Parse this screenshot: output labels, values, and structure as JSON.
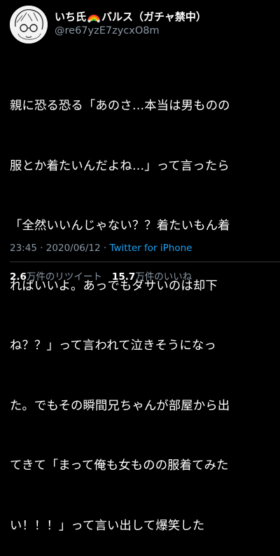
{
  "user": {
    "name_part1": "いち氏",
    "name_part2": "バルス（ガチャ禁中）",
    "handle": "@re67yzE7zycxO8m",
    "avatar_icon": "avatar-drawing-icon",
    "name_emoji_icon": "rainbow-icon"
  },
  "tweet": {
    "lines": [
      "親に恐る恐る「あのさ…本当は男ものの",
      "服とか着たいんだよね…」って言ったら",
      "「全然いいんじゃない？？着たいもん着",
      "ればいいよ。あっでもダサいのは却下",
      "ね？？」って言われて泣きそうになっ",
      "た。でもその瞬間兄ちゃんが部屋から出",
      "てきて「まって俺も女ものの服着てみた",
      "い！！！」って言い出して爆笑した"
    ]
  },
  "meta": {
    "time": "23:45",
    "date": "2020/06/12",
    "separator": "·",
    "source": "Twitter for iPhone"
  },
  "stats": {
    "retweets_count": "2.6",
    "retweets_label": "万件のリツイート",
    "likes_count": "15.7",
    "likes_label": "万件のいいね"
  },
  "colors": {
    "background": "#000000",
    "text": "#ffffff",
    "secondary": "#8b98a5",
    "link": "#1da1f2",
    "divider": "#2f3336"
  }
}
